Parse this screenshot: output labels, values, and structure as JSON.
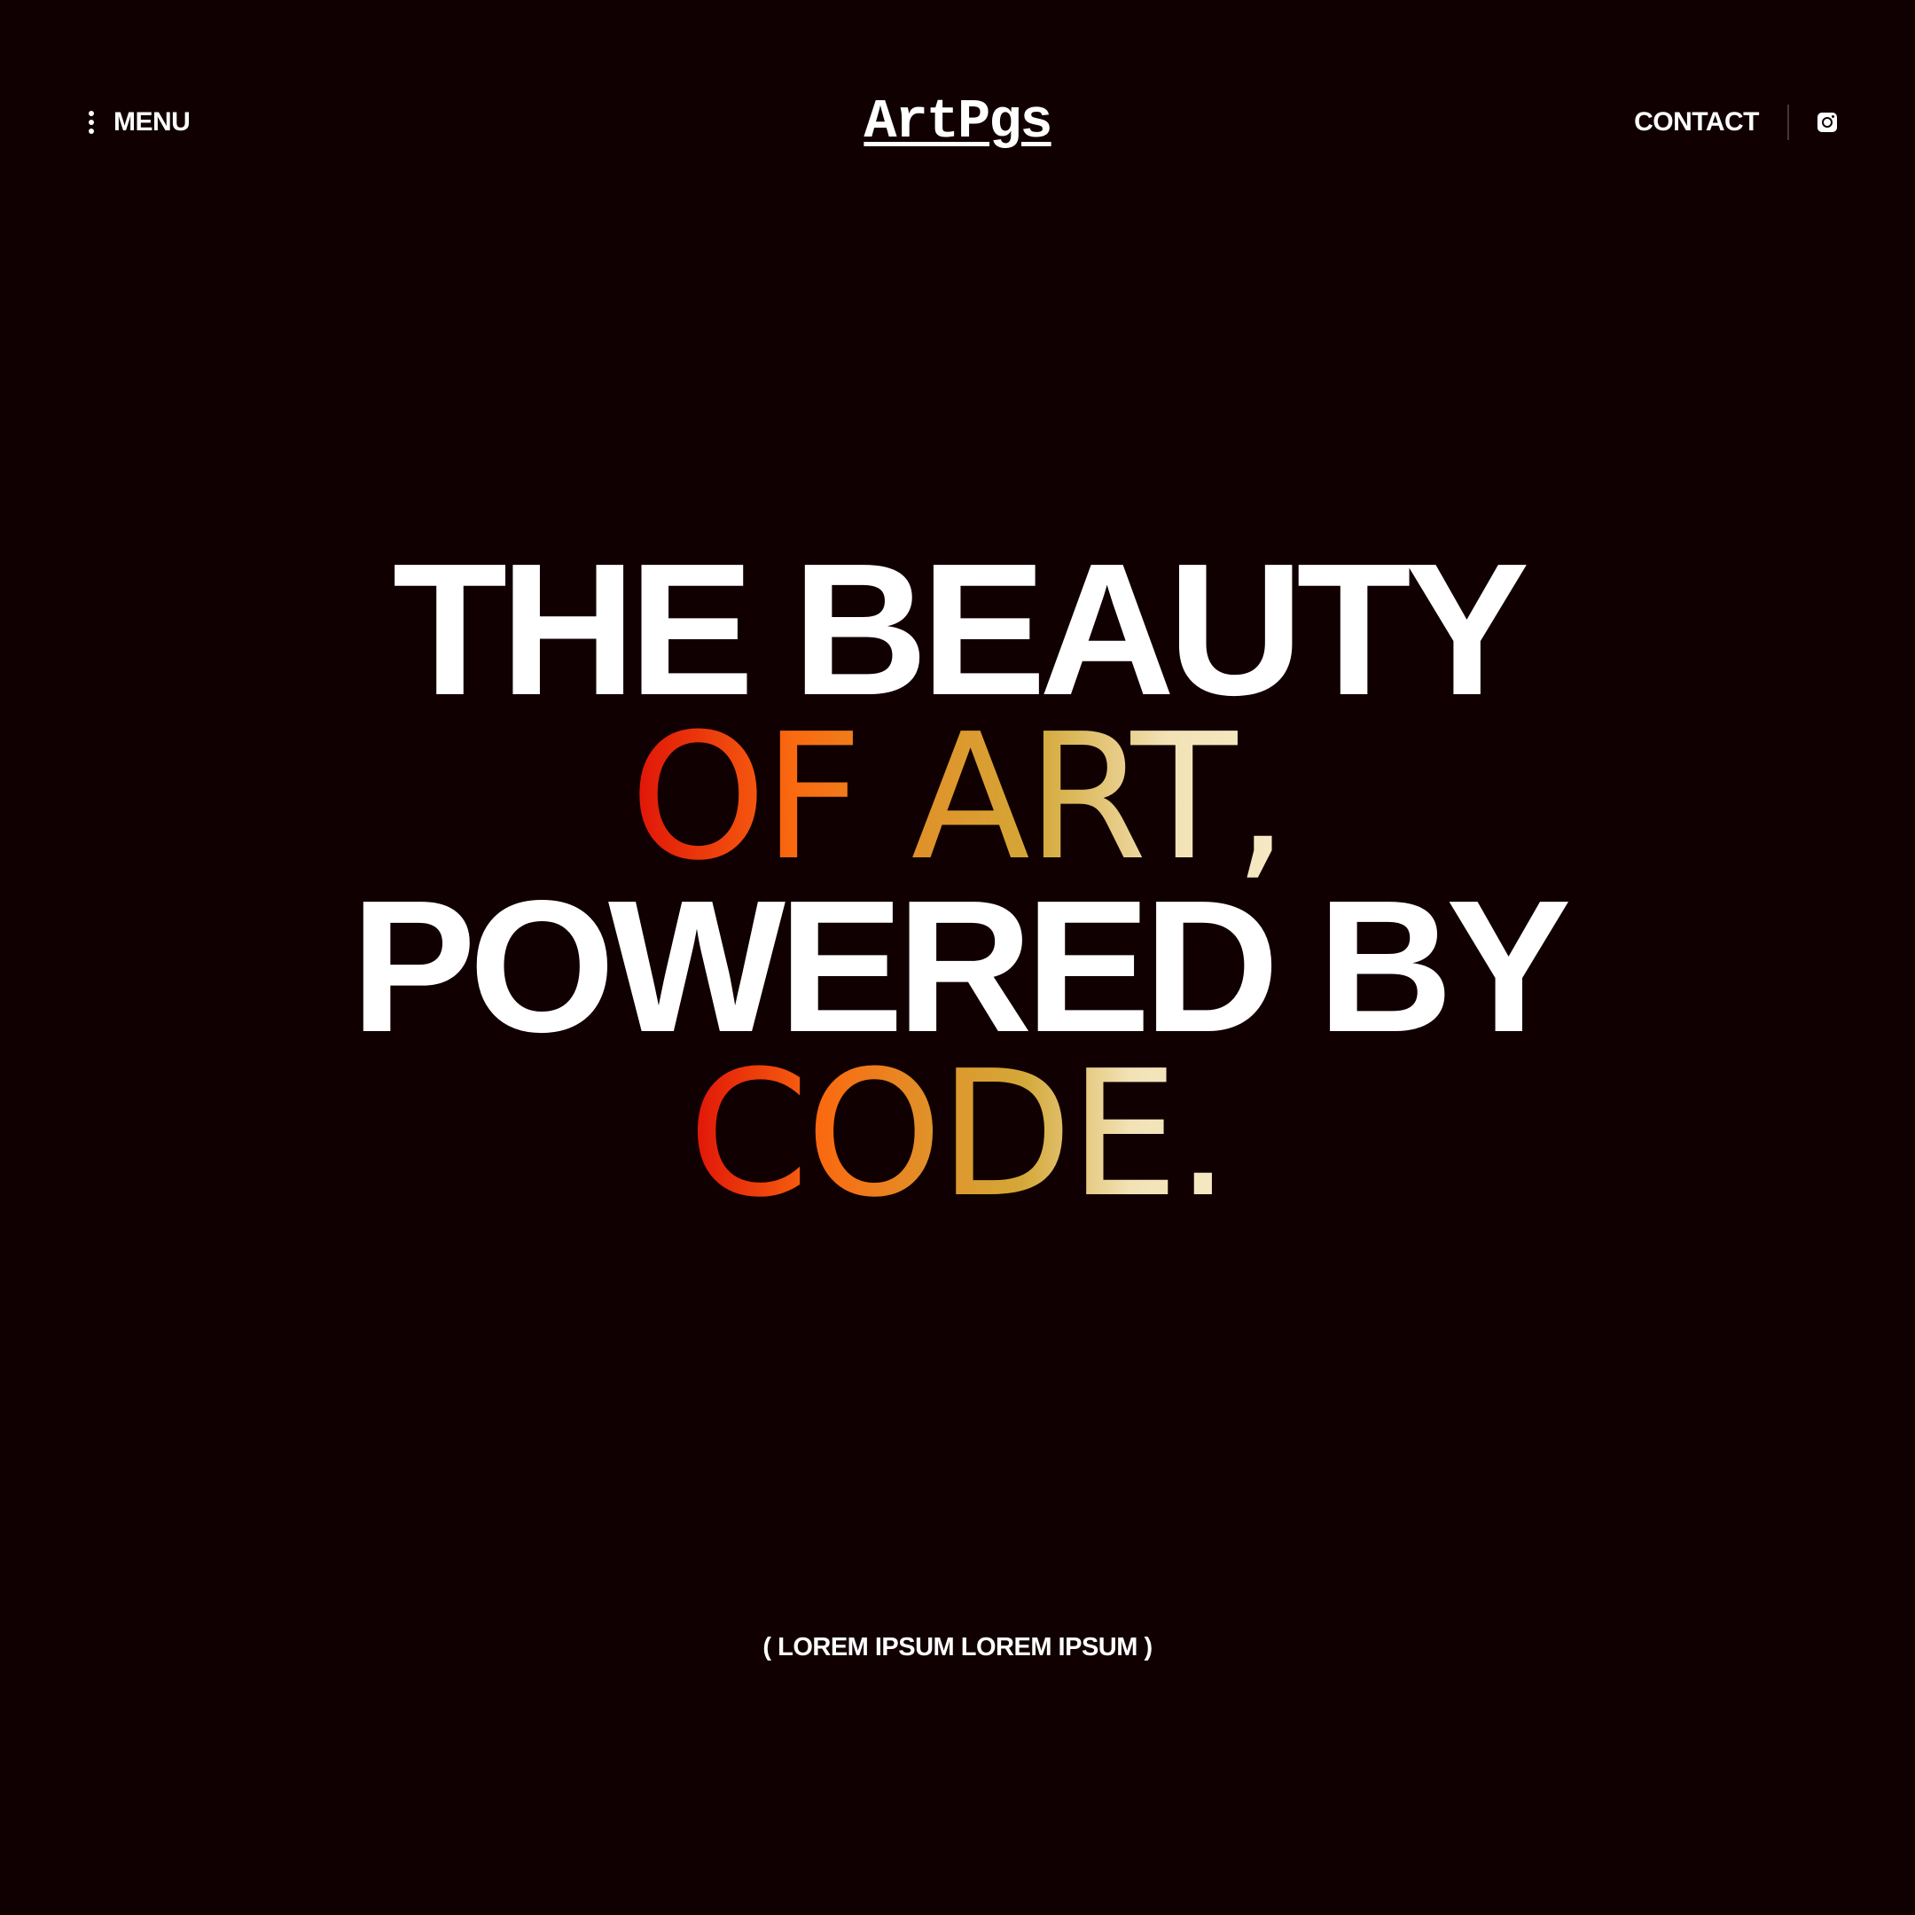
{
  "header": {
    "menu_label": "MENU",
    "logo_text": "ArtPgs",
    "contact_label": "CONTACT"
  },
  "hero": {
    "line1": "THE BEAUTY",
    "line2": "OF ART,",
    "line3": "POWERED BY",
    "line4": "CODE."
  },
  "tagline": "( LOREM IPSUM LOREM IPSUM )",
  "colors": {
    "background": "#110002",
    "text": "#ffffff",
    "gradient_start": "#df1208",
    "gradient_mid": "#fa6a10",
    "gradient_gold": "#d4a838",
    "gradient_end": "#f6e9c4"
  },
  "icons": {
    "menu": "kebab-dots-icon",
    "social": "instagram-icon"
  }
}
